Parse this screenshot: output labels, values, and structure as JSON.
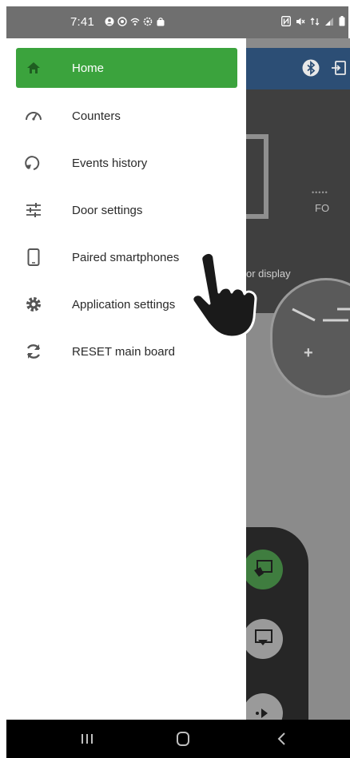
{
  "status_bar": {
    "time": "7:41",
    "left_icons": [
      "account-icon",
      "location-icon",
      "wifi-icon",
      "settings-icon",
      "bag-icon"
    ],
    "right_icons": [
      "nfc-icon",
      "mute-icon",
      "mobile-data-icon",
      "signal-icon",
      "battery-icon"
    ]
  },
  "background_app": {
    "fo_label": "FO",
    "display_label": "or display",
    "accent_color": "#2c4e75"
  },
  "drawer": {
    "active_color": "#3ba33d",
    "items": [
      {
        "label": "Home",
        "icon": "home-icon",
        "active": true
      },
      {
        "label": "Counters",
        "icon": "speedometer-icon",
        "active": false
      },
      {
        "label": "Events history",
        "icon": "history-icon",
        "active": false
      },
      {
        "label": "Door settings",
        "icon": "sliders-icon",
        "active": false
      },
      {
        "label": "Paired smartphones",
        "icon": "smartphone-icon",
        "active": false
      },
      {
        "label": "Application settings",
        "icon": "gear-icon",
        "active": false
      },
      {
        "label": "RESET main board",
        "icon": "reset-icon",
        "active": false
      }
    ]
  },
  "nav_bar": {
    "buttons": [
      "recents-button",
      "home-button",
      "back-button"
    ]
  }
}
